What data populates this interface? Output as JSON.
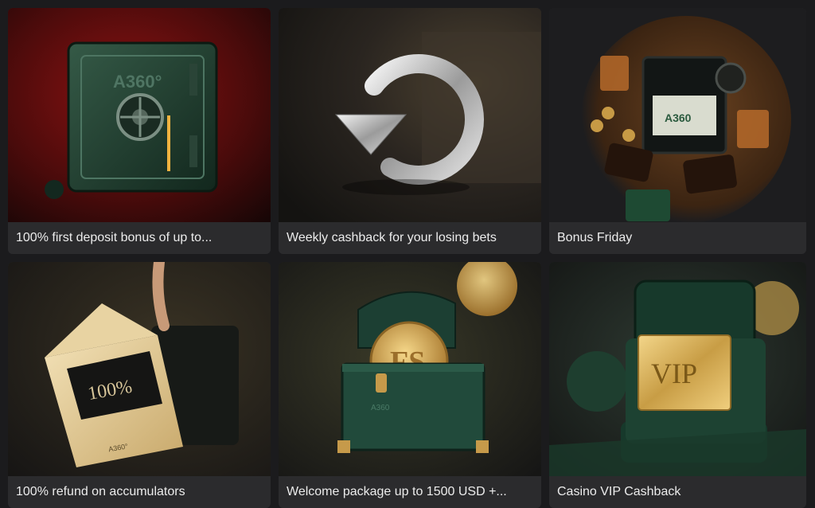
{
  "promotions": [
    {
      "title": "100% first deposit bonus of up to...",
      "image": "safe-icon",
      "brand": "A360°"
    },
    {
      "title": "Weekly cashback for your losing bets",
      "image": "refresh-arrow-icon"
    },
    {
      "title": "Bonus Friday",
      "image": "table-cards-icon",
      "brand": "A360"
    },
    {
      "title": "100% refund on accumulators",
      "image": "envelope-icon",
      "badge": "100%",
      "brand": "A360°"
    },
    {
      "title": "Welcome package up to 1500 USD +...",
      "image": "treasure-chest-icon",
      "badge": "FS",
      "brand": "A360"
    },
    {
      "title": "Casino VIP Cashback",
      "image": "vip-card-icon",
      "badge": "VIP"
    }
  ],
  "colors": {
    "page_bg": "#1b1b1d",
    "caption_bg": "#2b2b2d",
    "caption_text": "#ececec",
    "gold": "#d8b25a",
    "green": "#1f4a3a"
  }
}
